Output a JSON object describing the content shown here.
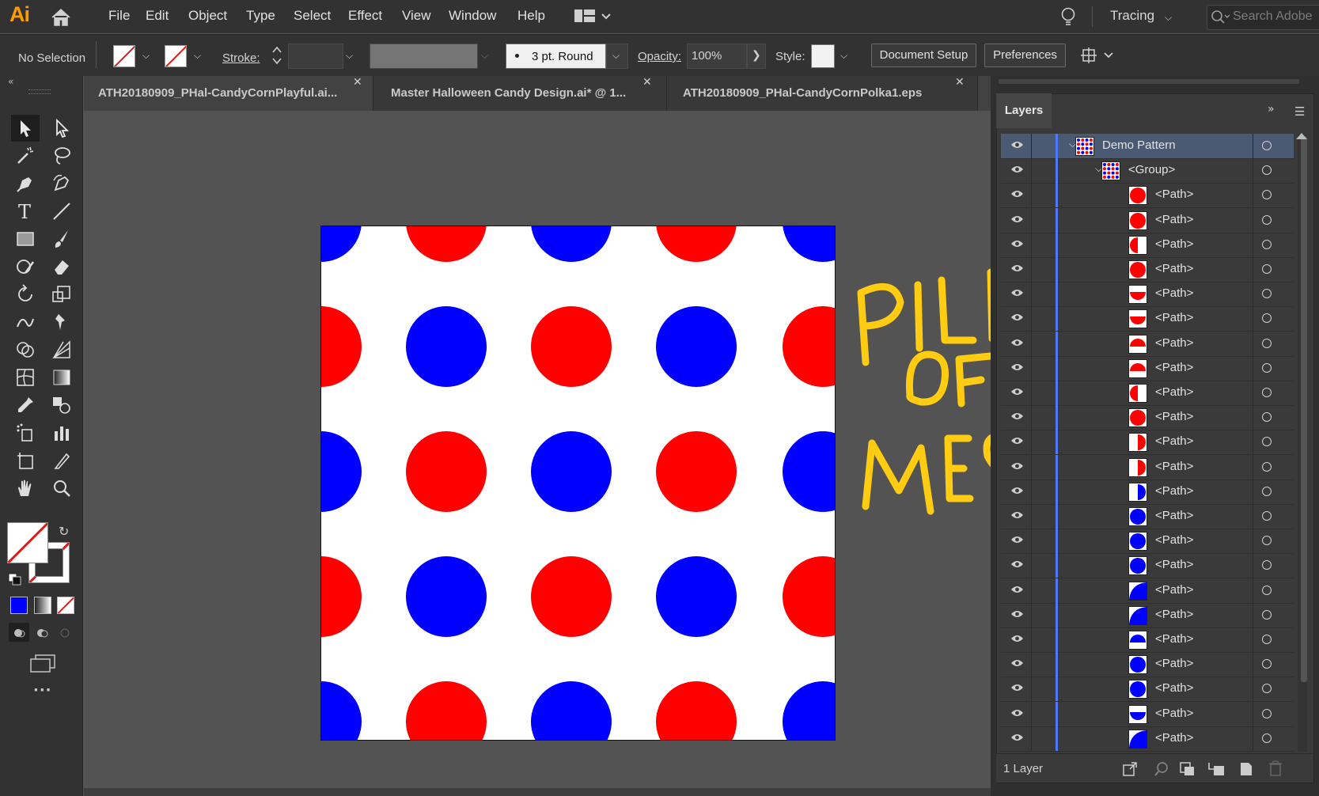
{
  "app": {
    "logo": "Ai"
  },
  "menu": [
    "File",
    "Edit",
    "Object",
    "Type",
    "Select",
    "Effect",
    "View",
    "Window",
    "Help"
  ],
  "workspace": {
    "label": "Tracing",
    "search_placeholder": "Search Adobe"
  },
  "control": {
    "selection": "No Selection",
    "stroke_label": "Stroke:",
    "brush": "3 pt. Round",
    "opacity_label": "Opacity:",
    "opacity_value": "100%",
    "style_label": "Style:",
    "document_setup": "Document Setup",
    "preferences": "Preferences"
  },
  "tabs": [
    {
      "label": "ATH20180909_PHal-CandyCornPlayful.ai..."
    },
    {
      "label": "Master Halloween Candy Design.ai* @ 1..."
    },
    {
      "label": "ATH20180909_PHal-CandyCornPolka1.eps"
    }
  ],
  "artboard": {
    "dot_colors": {
      "red": "#ff0000",
      "blue": "#0000ff"
    }
  },
  "annotation": {
    "line1": "PILE",
    "line2": "OF",
    "line3": "MESS",
    "color": "#ffcc11"
  },
  "layers": {
    "panel_title": "Layers",
    "top_layer": "Demo Pattern",
    "group": "<Group>",
    "paths": [
      "<Path>",
      "<Path>",
      "<Path>",
      "<Path>",
      "<Path>",
      "<Path>",
      "<Path>",
      "<Path>",
      "<Path>",
      "<Path>",
      "<Path>",
      "<Path>",
      "<Path>",
      "<Path>",
      "<Path>",
      "<Path>",
      "<Path>",
      "<Path>",
      "<Path>",
      "<Path>",
      "<Path>",
      "<Path>",
      "<Path>"
    ],
    "footer": "1 Layer"
  }
}
